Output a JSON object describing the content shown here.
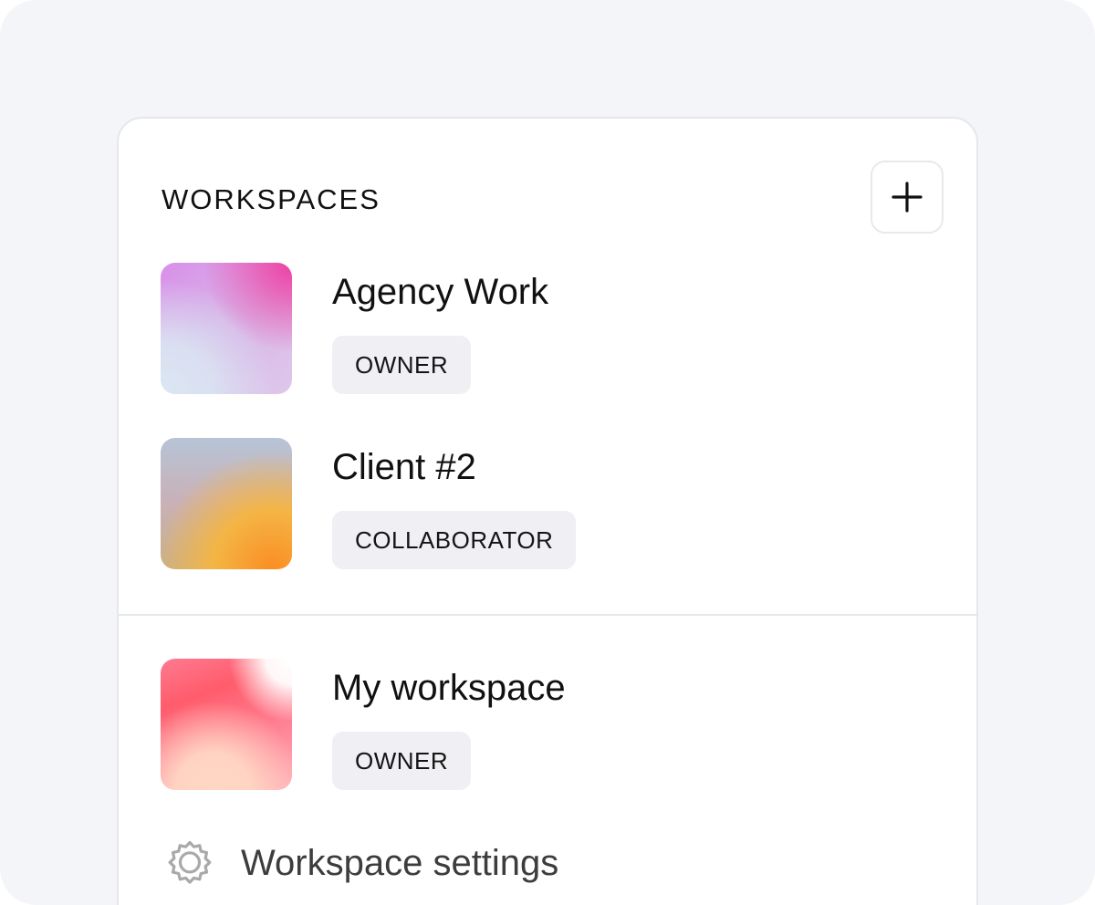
{
  "panel": {
    "section_title": "WORKSPACES",
    "add_button_icon": "plus-icon"
  },
  "workspaces": [
    {
      "name": "Agency Work",
      "role": "OWNER"
    },
    {
      "name": "Client #2",
      "role": "COLLABORATOR"
    }
  ],
  "personal_workspace": {
    "name": "My workspace",
    "role": "OWNER"
  },
  "settings": {
    "label": "Workspace settings",
    "icon": "gear-icon"
  },
  "colors": {
    "background": "#f4f5f9",
    "panel": "#ffffff",
    "badge": "#efeff4",
    "text": "#111111",
    "muted_text": "#3d3d3d",
    "divider": "#e7e8ed"
  }
}
